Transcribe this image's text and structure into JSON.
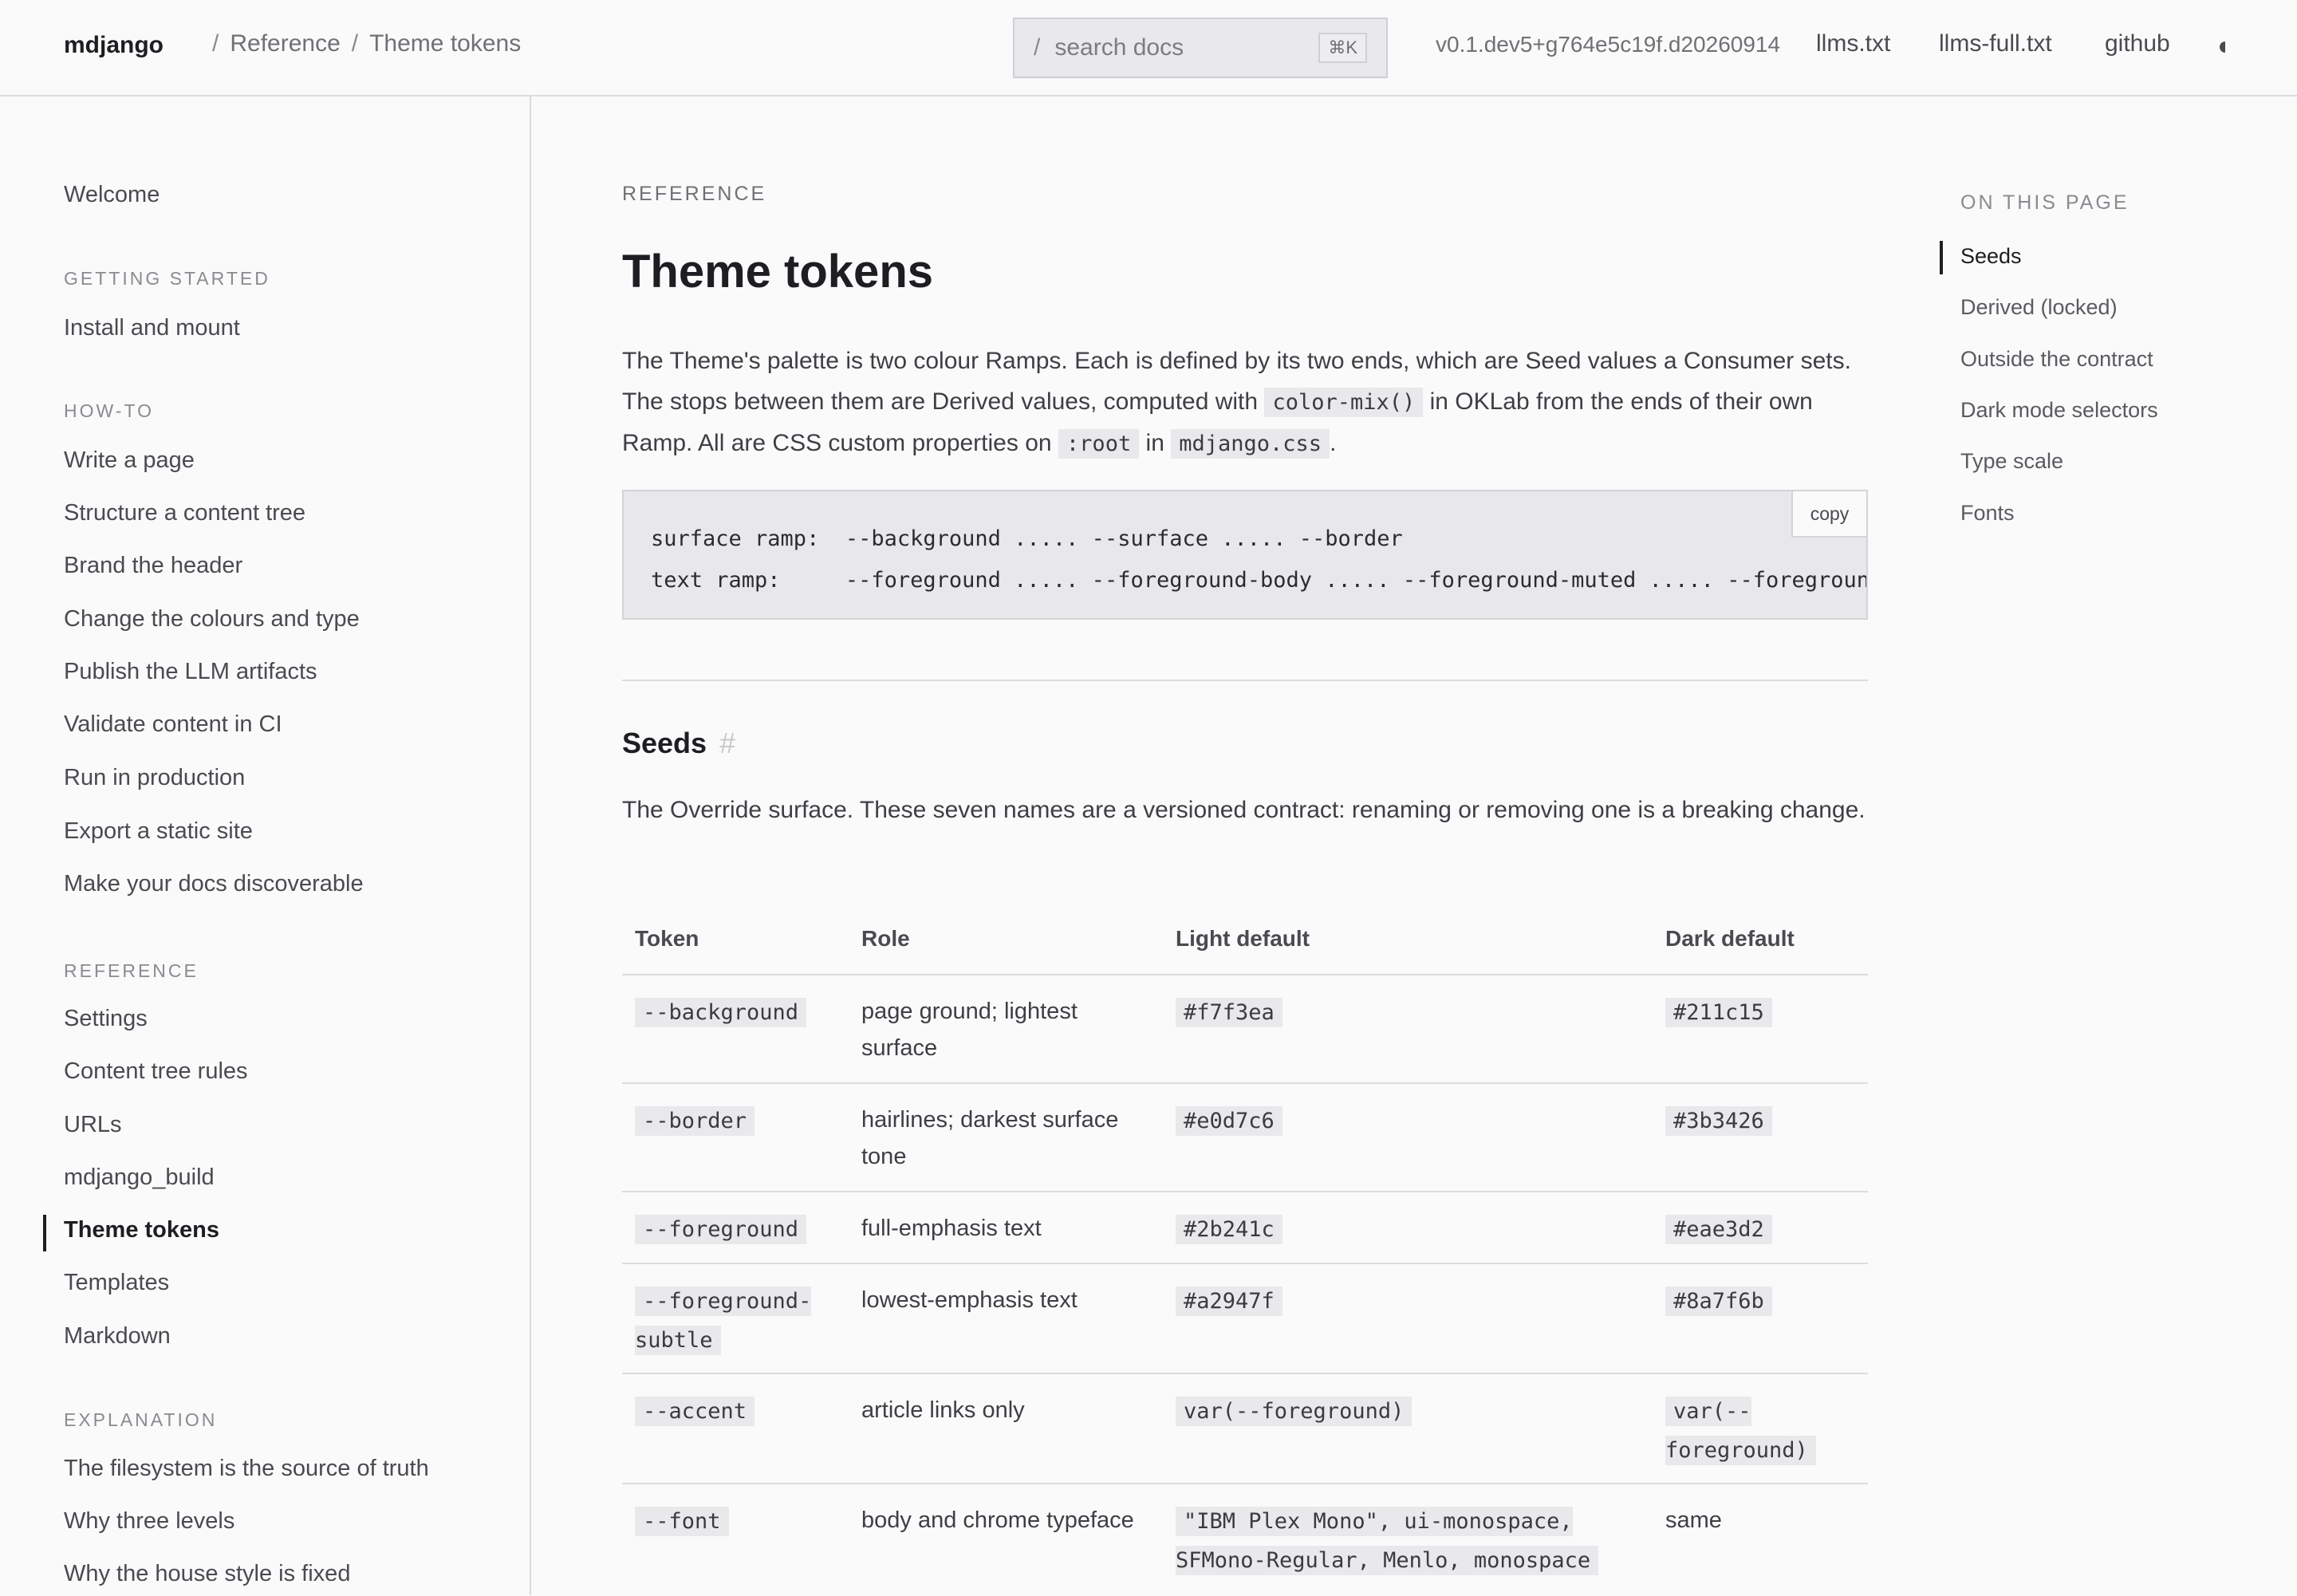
{
  "header": {
    "brand": "mdjango",
    "breadcrumb": [
      "Reference",
      "Theme tokens"
    ],
    "breadcrumb_sep": "/",
    "search": {
      "prefix": "/",
      "placeholder": "search docs",
      "shortcut": "⌘K"
    },
    "version": "v0.1.dev5+g764e5c19f.d20260914",
    "links": [
      "llms.txt",
      "llms-full.txt",
      "github"
    ],
    "theme_toggle_icon": "half-moon-icon"
  },
  "sidebar": {
    "welcome": "Welcome",
    "sections": [
      {
        "title": "GETTING STARTED",
        "items": [
          "Install and mount"
        ]
      },
      {
        "title": "HOW-TO",
        "items": [
          "Write a page",
          "Structure a content tree",
          "Brand the header",
          "Change the colours and type",
          "Publish the LLM artifacts",
          "Validate content in CI",
          "Run in production",
          "Export a static site",
          "Make your docs discoverable"
        ]
      },
      {
        "title": "REFERENCE",
        "items": [
          "Settings",
          "Content tree rules",
          "URLs",
          "mdjango_build",
          "Theme tokens",
          "Templates",
          "Markdown"
        ]
      },
      {
        "title": "EXPLANATION",
        "items": [
          "The filesystem is the source of truth",
          "Why three levels",
          "Why the house style is fixed"
        ]
      }
    ],
    "active": "Theme tokens"
  },
  "main": {
    "eyebrow": "REFERENCE",
    "title": "Theme tokens",
    "lead": {
      "t1": "The Theme's palette is two colour Ramps. Each is defined by its two ends, which are Seed values a Consumer sets. The stops between them are Derived values, computed with",
      "c1": "color-mix()",
      "t2": "in OKLab from the ends of their own Ramp. All are CSS custom properties on",
      "c2": ":root",
      "t3": "in",
      "c3": "mdjango.css",
      "t4": "."
    },
    "code": {
      "line1": "surface ramp:  --background ..... --surface ..... --border",
      "line2": "text ramp:     --foreground ..... --foreground-body ..... --foreground-muted ..... --foreground",
      "copy_label": "copy"
    },
    "seeds": {
      "heading": "Seeds",
      "anchor": "#",
      "para": "The Override surface. These seven names are a versioned contract: renaming or removing one is a breaking change."
    },
    "table": {
      "headers": [
        "Token",
        "Role",
        "Light default",
        "Dark default"
      ],
      "rows": [
        {
          "token": "--background",
          "role": "page ground; lightest surface",
          "light": "#f7f3ea",
          "dark": "#211c15"
        },
        {
          "token": "--border",
          "role": "hairlines; darkest surface tone",
          "light": "#e0d7c6",
          "dark": "#3b3426"
        },
        {
          "token": "--foreground",
          "role": "full-emphasis text",
          "light": "#2b241c",
          "dark": "#eae3d2"
        },
        {
          "token": "--foreground-subtle",
          "role": "lowest-emphasis text",
          "light": "#a2947f",
          "dark": "#8a7f6b"
        },
        {
          "token": "--accent",
          "role": "article links only",
          "light": "var(--foreground)",
          "dark": "var(--foreground)"
        },
        {
          "token": "--font",
          "role": "body and chrome typeface",
          "light": "\"IBM Plex Mono\", ui-monospace, SFMono-Regular, Menlo, monospace",
          "dark": "same"
        }
      ]
    }
  },
  "toc": {
    "heading": "ON THIS PAGE",
    "items": [
      "Seeds",
      "Derived (locked)",
      "Outside the contract",
      "Dark mode selectors",
      "Type scale",
      "Fonts"
    ],
    "active": "Seeds"
  }
}
